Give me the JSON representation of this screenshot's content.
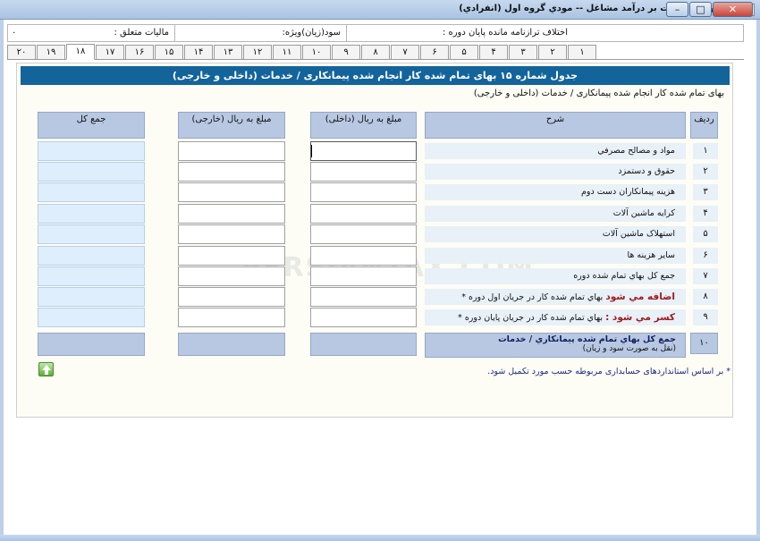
{
  "window": {
    "title": "اظهارنامه مالیات بر درآمد مشاغل -- مودي گروه اول (انفرادي)",
    "min_label": "–",
    "max_label": "□",
    "close_label": "✕"
  },
  "header": {
    "diff_label": "اختلاف ترازنامه مانده پایان دوره :",
    "profit_label": "سود(زیان)ویژه:",
    "tax_label": "مالیات متعلق :",
    "tax_value": "۰"
  },
  "tabs": [
    "۱",
    "۲",
    "۳",
    "۴",
    "۵",
    "۶",
    "۷",
    "۸",
    "۹",
    "۱۰",
    "۱۱",
    "۱۲",
    "۱۳",
    "۱۴",
    "۱۵",
    "۱۶",
    "۱۷",
    "۱۸",
    "۱۹",
    "۲۰"
  ],
  "active_tab": "۱۸",
  "form": {
    "banner": "جدول شماره ۱۵ بهای تمام شده کار انجام شده پیمانکاری / خدمات (داخلی و خارجی)",
    "subtitle": "بهای تمام شده کار انجام شده پیمانکاری / خدمات (داخلی و خارجی)",
    "col_row": "ردیف",
    "col_desc": "شرح",
    "col_internal": "مبلغ به ریال (داخلی)",
    "col_external": "مبلغ به ریال (خارجی)",
    "col_total": "جمع کل",
    "rows": [
      {
        "num": "۱",
        "desc": "مواد و مصالح مصرفي"
      },
      {
        "num": "۲",
        "desc": "حقوق و دستمزد"
      },
      {
        "num": "۳",
        "desc": "هزینه پیمانکاران دست دوم"
      },
      {
        "num": "۴",
        "desc": "کرایه ماشین آلات"
      },
      {
        "num": "۵",
        "desc": "استهلاک ماشین آلات"
      },
      {
        "num": "۶",
        "desc": "سایر هزینه ها"
      },
      {
        "num": "۷",
        "desc": "جمع کل بهاي تمام شده دوره"
      },
      {
        "num": "۸",
        "desc_prefix": "اضافه مي شود",
        "desc": "بهاي تمام شده کار در جریان اول دوره *"
      },
      {
        "num": "۹",
        "desc_prefix": "کسر مي شود :",
        "desc": "بهاي تمام شده کار در جریان پایان دوره *"
      }
    ],
    "total_row": {
      "num": "۱۰",
      "desc": "جمع کل بهاي تمام شده پیمانکاري / خدمات",
      "note": "(نقل به صورت سود و زیان)"
    },
    "footnote": "* بر اساس استانداردهای حسابداری مربوطه حسب مورد تکمیل شود."
  },
  "watermark": "PERSIANTAX.COM"
}
